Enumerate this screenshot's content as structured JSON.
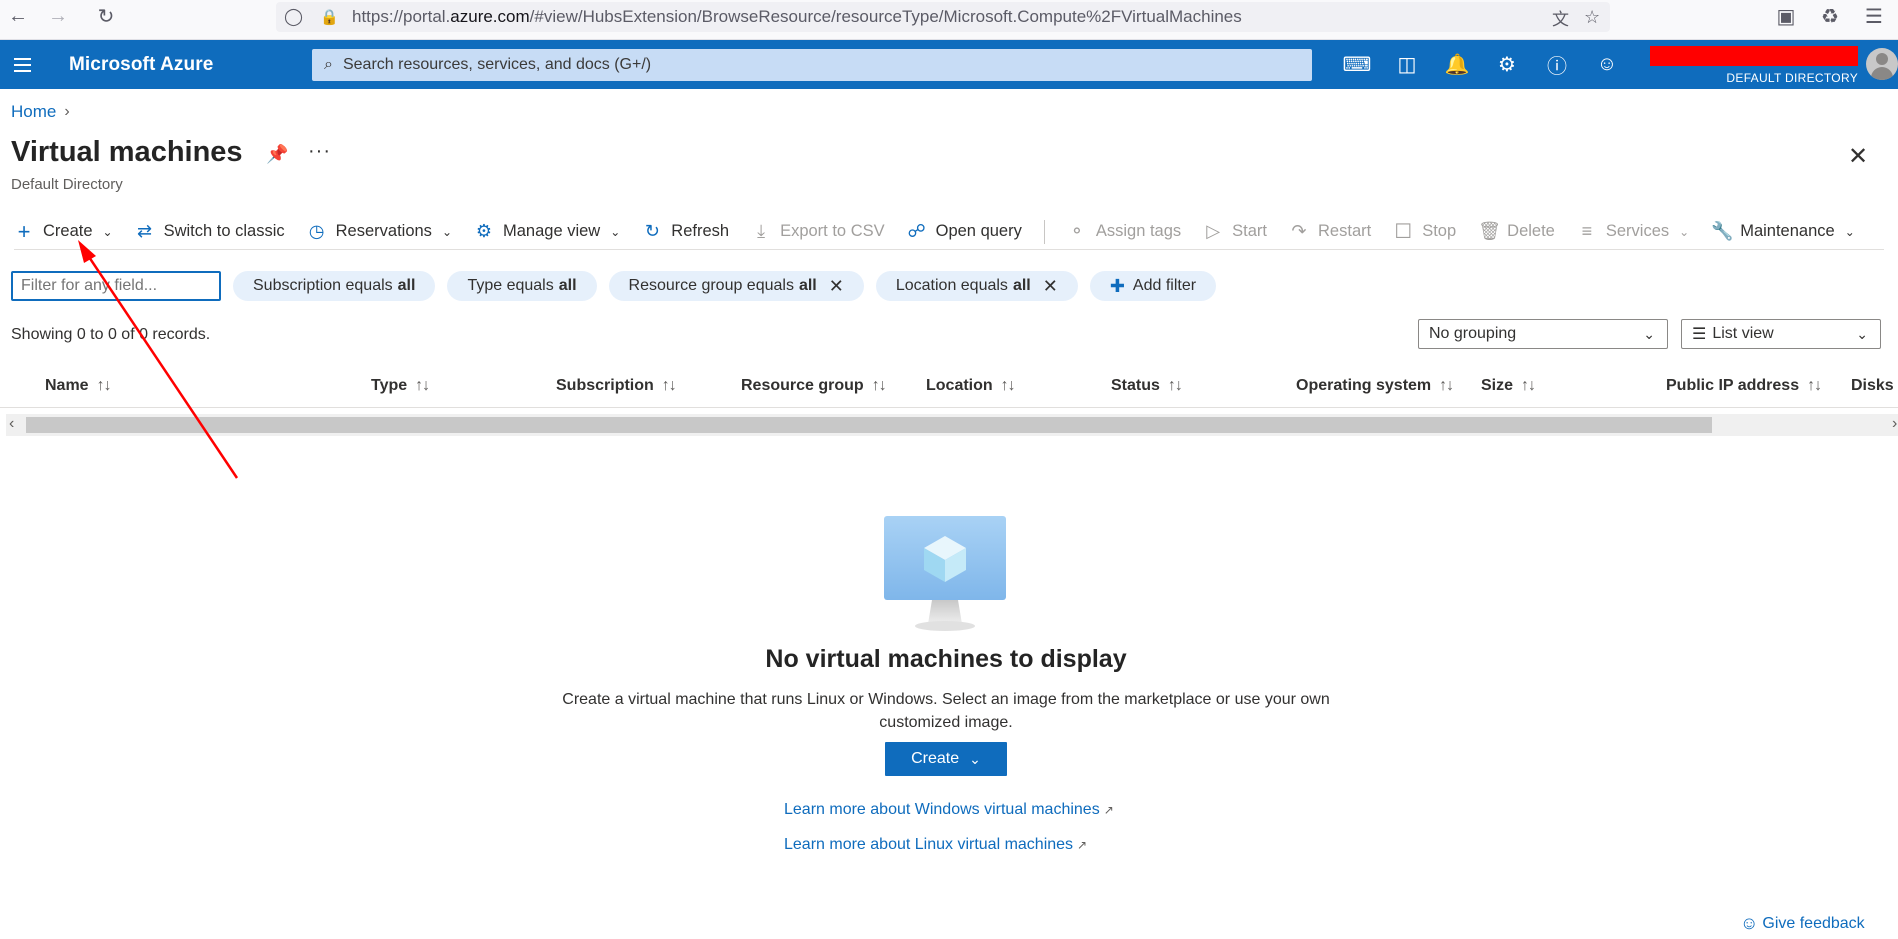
{
  "browser": {
    "url_prefix": "https://portal.",
    "url_host": "azure.com",
    "url_path": "/#view/HubsExtension/BrowseResource/resourceType/Microsoft.Compute%2FVirtualMachines"
  },
  "header": {
    "brand": "Microsoft Azure",
    "search_placeholder": "Search resources, services, and docs (G+/)",
    "directory": "DEFAULT DIRECTORY"
  },
  "breadcrumb": {
    "home": "Home"
  },
  "page": {
    "title": "Virtual machines",
    "subtitle": "Default Directory"
  },
  "toolbar": {
    "create": "Create",
    "switch_classic": "Switch to classic",
    "reservations": "Reservations",
    "manage_view": "Manage view",
    "refresh": "Refresh",
    "export_csv": "Export to CSV",
    "open_query": "Open query",
    "assign_tags": "Assign tags",
    "start": "Start",
    "restart": "Restart",
    "stop": "Stop",
    "delete": "Delete",
    "services": "Services",
    "maintenance": "Maintenance"
  },
  "filters": {
    "placeholder": "Filter for any field...",
    "subscription": {
      "label": "Subscription equals",
      "value": "all"
    },
    "type": {
      "label": "Type equals",
      "value": "all"
    },
    "resource_group": {
      "label": "Resource group equals",
      "value": "all"
    },
    "location": {
      "label": "Location equals",
      "value": "all"
    },
    "add_filter": "Add filter"
  },
  "records_text": "Showing 0 to 0 of 0 records.",
  "grouping": "No grouping",
  "view": "List view",
  "columns": [
    "Name",
    "Type",
    "Subscription",
    "Resource group",
    "Location",
    "Status",
    "Operating system",
    "Size",
    "Public IP address",
    "Disks"
  ],
  "empty": {
    "title": "No virtual machines to display",
    "desc_line1": "Create a virtual machine that runs Linux or Windows. Select an image from the marketplace or use your own",
    "desc_line2": "customized image.",
    "create_button": "Create",
    "learn_windows": "Learn more about Windows virtual machines",
    "learn_linux": "Learn more about Linux virtual machines"
  },
  "feedback": "Give feedback",
  "colors": {
    "azure_blue": "#0f6cbd",
    "annotation_red": "#ff0000"
  }
}
